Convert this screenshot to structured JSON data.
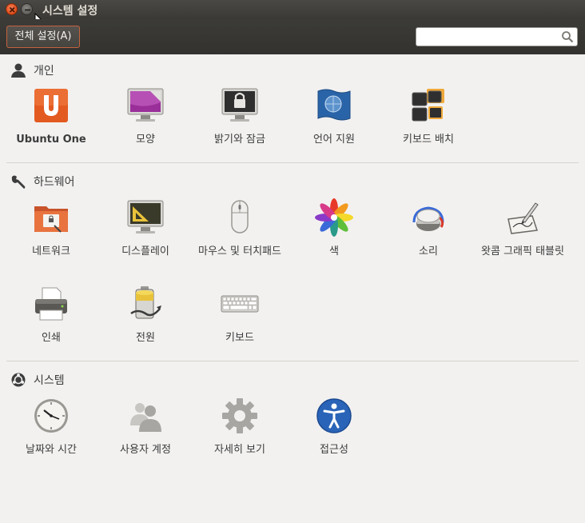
{
  "window": {
    "title": "시스템 설정"
  },
  "toolbar": {
    "all_settings_label": "전체 설정(A)",
    "search_placeholder": "",
    "search_value": ""
  },
  "sections": [
    {
      "title": "개인",
      "icon": "person-icon",
      "items": [
        {
          "label": "Ubuntu One",
          "icon": "ubuntu-one-icon"
        },
        {
          "label": "모양",
          "icon": "appearance-icon"
        },
        {
          "label": "밝기와 잠금",
          "icon": "brightness-lock-icon"
        },
        {
          "label": "언어 지원",
          "icon": "language-icon"
        },
        {
          "label": "키보드 배치",
          "icon": "keyboard-layout-icon"
        }
      ]
    },
    {
      "title": "하드웨어",
      "icon": "wrench-icon",
      "items": [
        {
          "label": "네트워크",
          "icon": "network-folder-icon"
        },
        {
          "label": "디스플레이",
          "icon": "display-icon"
        },
        {
          "label": "마우스 및 터치패드",
          "icon": "mouse-icon"
        },
        {
          "label": "색",
          "icon": "color-icon"
        },
        {
          "label": "소리",
          "icon": "sound-icon"
        },
        {
          "label": "왓콤 그래픽 태블릿",
          "icon": "wacom-tablet-icon"
        },
        {
          "label": "인쇄",
          "icon": "printer-icon"
        },
        {
          "label": "전원",
          "icon": "battery-icon"
        },
        {
          "label": "키보드",
          "icon": "keyboard-icon"
        }
      ]
    },
    {
      "title": "시스템",
      "icon": "ubuntu-logo-icon",
      "items": [
        {
          "label": "날짜와 시간",
          "icon": "clock-icon"
        },
        {
          "label": "사용자 계정",
          "icon": "users-icon"
        },
        {
          "label": "자세히 보기",
          "icon": "gear-icon"
        },
        {
          "label": "접근성",
          "icon": "accessibility-icon"
        }
      ]
    }
  ],
  "colors": {
    "accent": "#dd4814",
    "titlebar": "#3c3b37",
    "background": "#f2f1f0"
  }
}
